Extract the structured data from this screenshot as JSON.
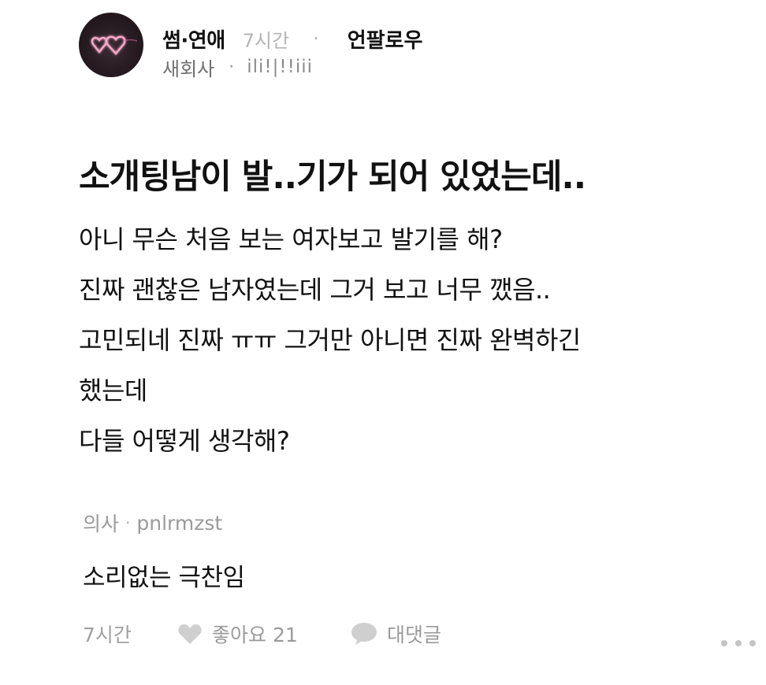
{
  "header": {
    "category": "썸·연애",
    "time": "7시간",
    "separator": "·",
    "unfollow_label": "언팔로우",
    "company": "새회사",
    "nickname": "ili!|!!iii"
  },
  "post": {
    "title": "소개팅남이 발..기가 되어 있었는데..",
    "body_lines": [
      "아니 무슨 처음 보는 여자보고 발기를 해?",
      "진짜 괜찮은 남자였는데 그거 보고 너무 깼음..",
      "고민되네 진짜 ㅠㅠ 그거만 아니면 진짜 완벽하긴",
      "했는데",
      "다들 어떻게 생각해?"
    ]
  },
  "comment_preview": {
    "author_job": "의사",
    "separator": "·",
    "author_name": "pnlrmzst",
    "text": "소리없는 극찬임"
  },
  "footer": {
    "time": "7시간",
    "like_label": "좋아요 21",
    "comment_label": "대댓글"
  },
  "icons": {
    "avatar_art": "neon-hearts",
    "like": "heart-icon",
    "comment": "speech-bubble-icon",
    "more": "more-dots-icon"
  },
  "colors": {
    "muted_text": "#9a9a9a",
    "light_text": "#b5b5b5",
    "neon_pink": "#f7a8c8"
  }
}
